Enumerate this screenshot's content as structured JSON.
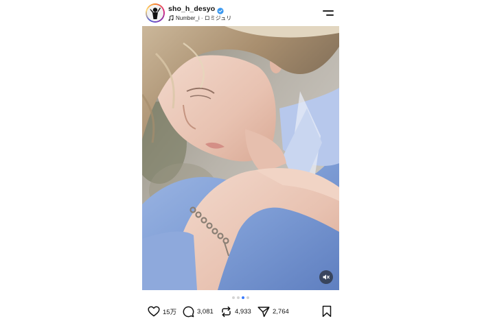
{
  "header": {
    "username": "sho_h_desyo",
    "music": "Number_i · ロミジュリ",
    "verified": true
  },
  "carousel": {
    "total": 4,
    "active_index": 2
  },
  "actions": {
    "likes": "15万",
    "comments": "3,081",
    "reposts": "4,933",
    "shares": "2,764"
  },
  "icons": {
    "like": "heart-icon",
    "comment": "comment-bubble-icon",
    "repost": "repost-icon",
    "share": "send-icon",
    "save": "bookmark-icon",
    "menu": "menu-icon",
    "mute": "speaker-muted-icon",
    "music": "music-note-icon",
    "verified": "verified-badge-icon"
  },
  "colors": {
    "verified": "#3897f0",
    "active_dot": "#3a7bfd",
    "inactive_dot": "#d4d4d4"
  }
}
